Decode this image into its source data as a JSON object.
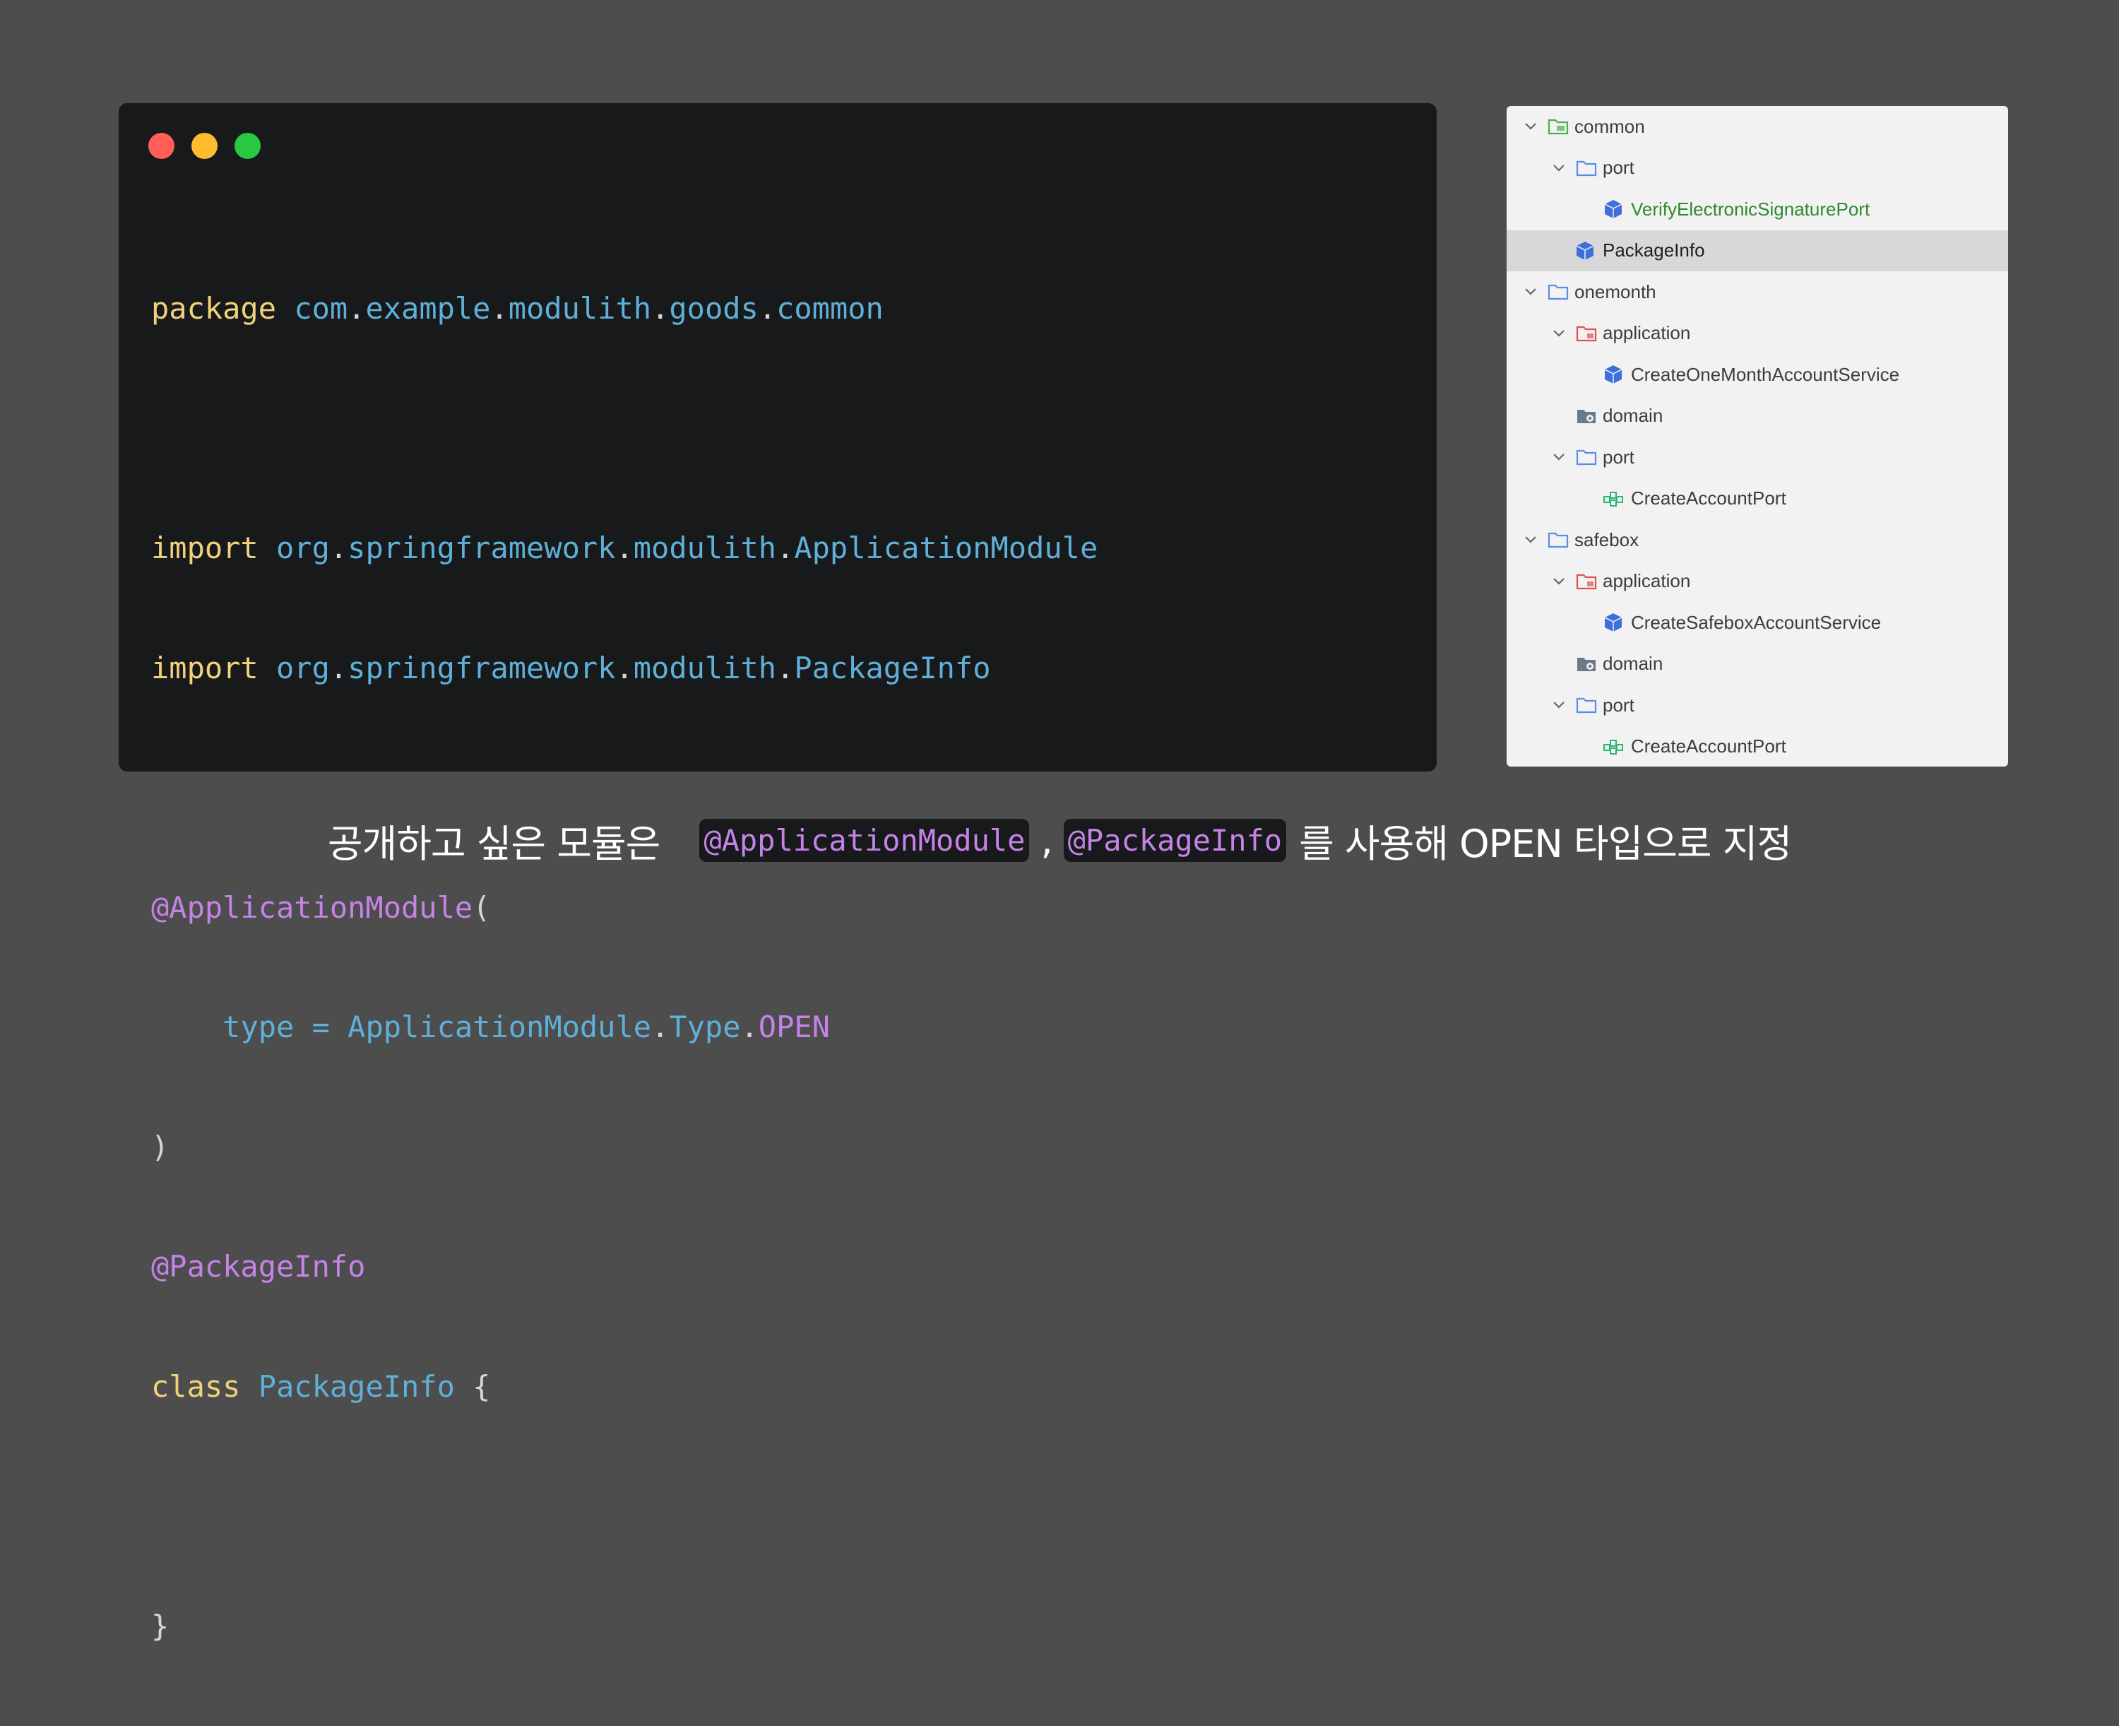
{
  "window": {
    "controls": [
      "close",
      "minimize",
      "zoom"
    ]
  },
  "code": {
    "line1": {
      "kw": "package",
      "pkg": [
        "com",
        ".",
        "example",
        ".",
        "modulith",
        ".",
        "goods",
        ".",
        "common"
      ]
    },
    "line3": {
      "kw": "import",
      "pkg": [
        "org",
        ".",
        "springframework",
        ".",
        "modulith",
        ".",
        "ApplicationModule"
      ]
    },
    "line4": {
      "kw": "import",
      "pkg": [
        "org",
        ".",
        "springframework",
        ".",
        "modulith",
        ".",
        "PackageInfo"
      ]
    },
    "line6": {
      "ann": "@ApplicationModule",
      "paren": "("
    },
    "line7": {
      "indent": "    ",
      "prop": "type",
      "eq": " = ",
      "cls": "ApplicationModule",
      "d1": ".",
      "type": "Type",
      "d2": ".",
      "val": "OPEN"
    },
    "line8": {
      "close": ")"
    },
    "line9": {
      "ann": "@PackageInfo"
    },
    "line10": {
      "kw": "class",
      "cls": "PackageInfo",
      "brace": " {"
    },
    "line12": {
      "brace": "}"
    }
  },
  "tree": {
    "items": [
      {
        "label": "common",
        "icon": "folder-module-icon",
        "expanded": true
      },
      {
        "label": "port",
        "icon": "folder-icon",
        "expanded": true
      },
      {
        "label": "VerifyElectronicSignaturePort",
        "icon": "class-icon"
      },
      {
        "label": "PackageInfo",
        "icon": "class-icon",
        "selected": true
      },
      {
        "label": "onemonth",
        "icon": "folder-icon",
        "expanded": true
      },
      {
        "label": "application",
        "icon": "folder-red-icon",
        "expanded": true
      },
      {
        "label": "CreateOneMonthAccountService",
        "icon": "class-icon"
      },
      {
        "label": "domain",
        "icon": "folder-gear-icon"
      },
      {
        "label": "port",
        "icon": "folder-icon",
        "expanded": true
      },
      {
        "label": "CreateAccountPort",
        "icon": "interface-icon"
      },
      {
        "label": "safebox",
        "icon": "folder-icon",
        "expanded": true
      },
      {
        "label": "application",
        "icon": "folder-red-icon",
        "expanded": true
      },
      {
        "label": "CreateSafeboxAccountService",
        "icon": "class-icon"
      },
      {
        "label": "domain",
        "icon": "folder-gear-icon"
      },
      {
        "label": "port",
        "icon": "folder-icon",
        "expanded": true
      },
      {
        "label": "CreateAccountPort",
        "icon": "interface-icon"
      }
    ]
  },
  "caption": {
    "before": "공개하고 싶은 모듈은",
    "chip1": "@ApplicationModule",
    "comma": ",",
    "chip2": "@PackageInfo",
    "after": "를 사용해 OPEN 타입으로 지정"
  },
  "colors": {
    "background": "#4d4d4d",
    "editor": "#18191b",
    "keyword": "#f0d27a",
    "identifier": "#5fb0d8",
    "annotation": "#c583e8",
    "tree_bg": "#f2f2f2",
    "tree_selected": "#d8d8d8"
  }
}
